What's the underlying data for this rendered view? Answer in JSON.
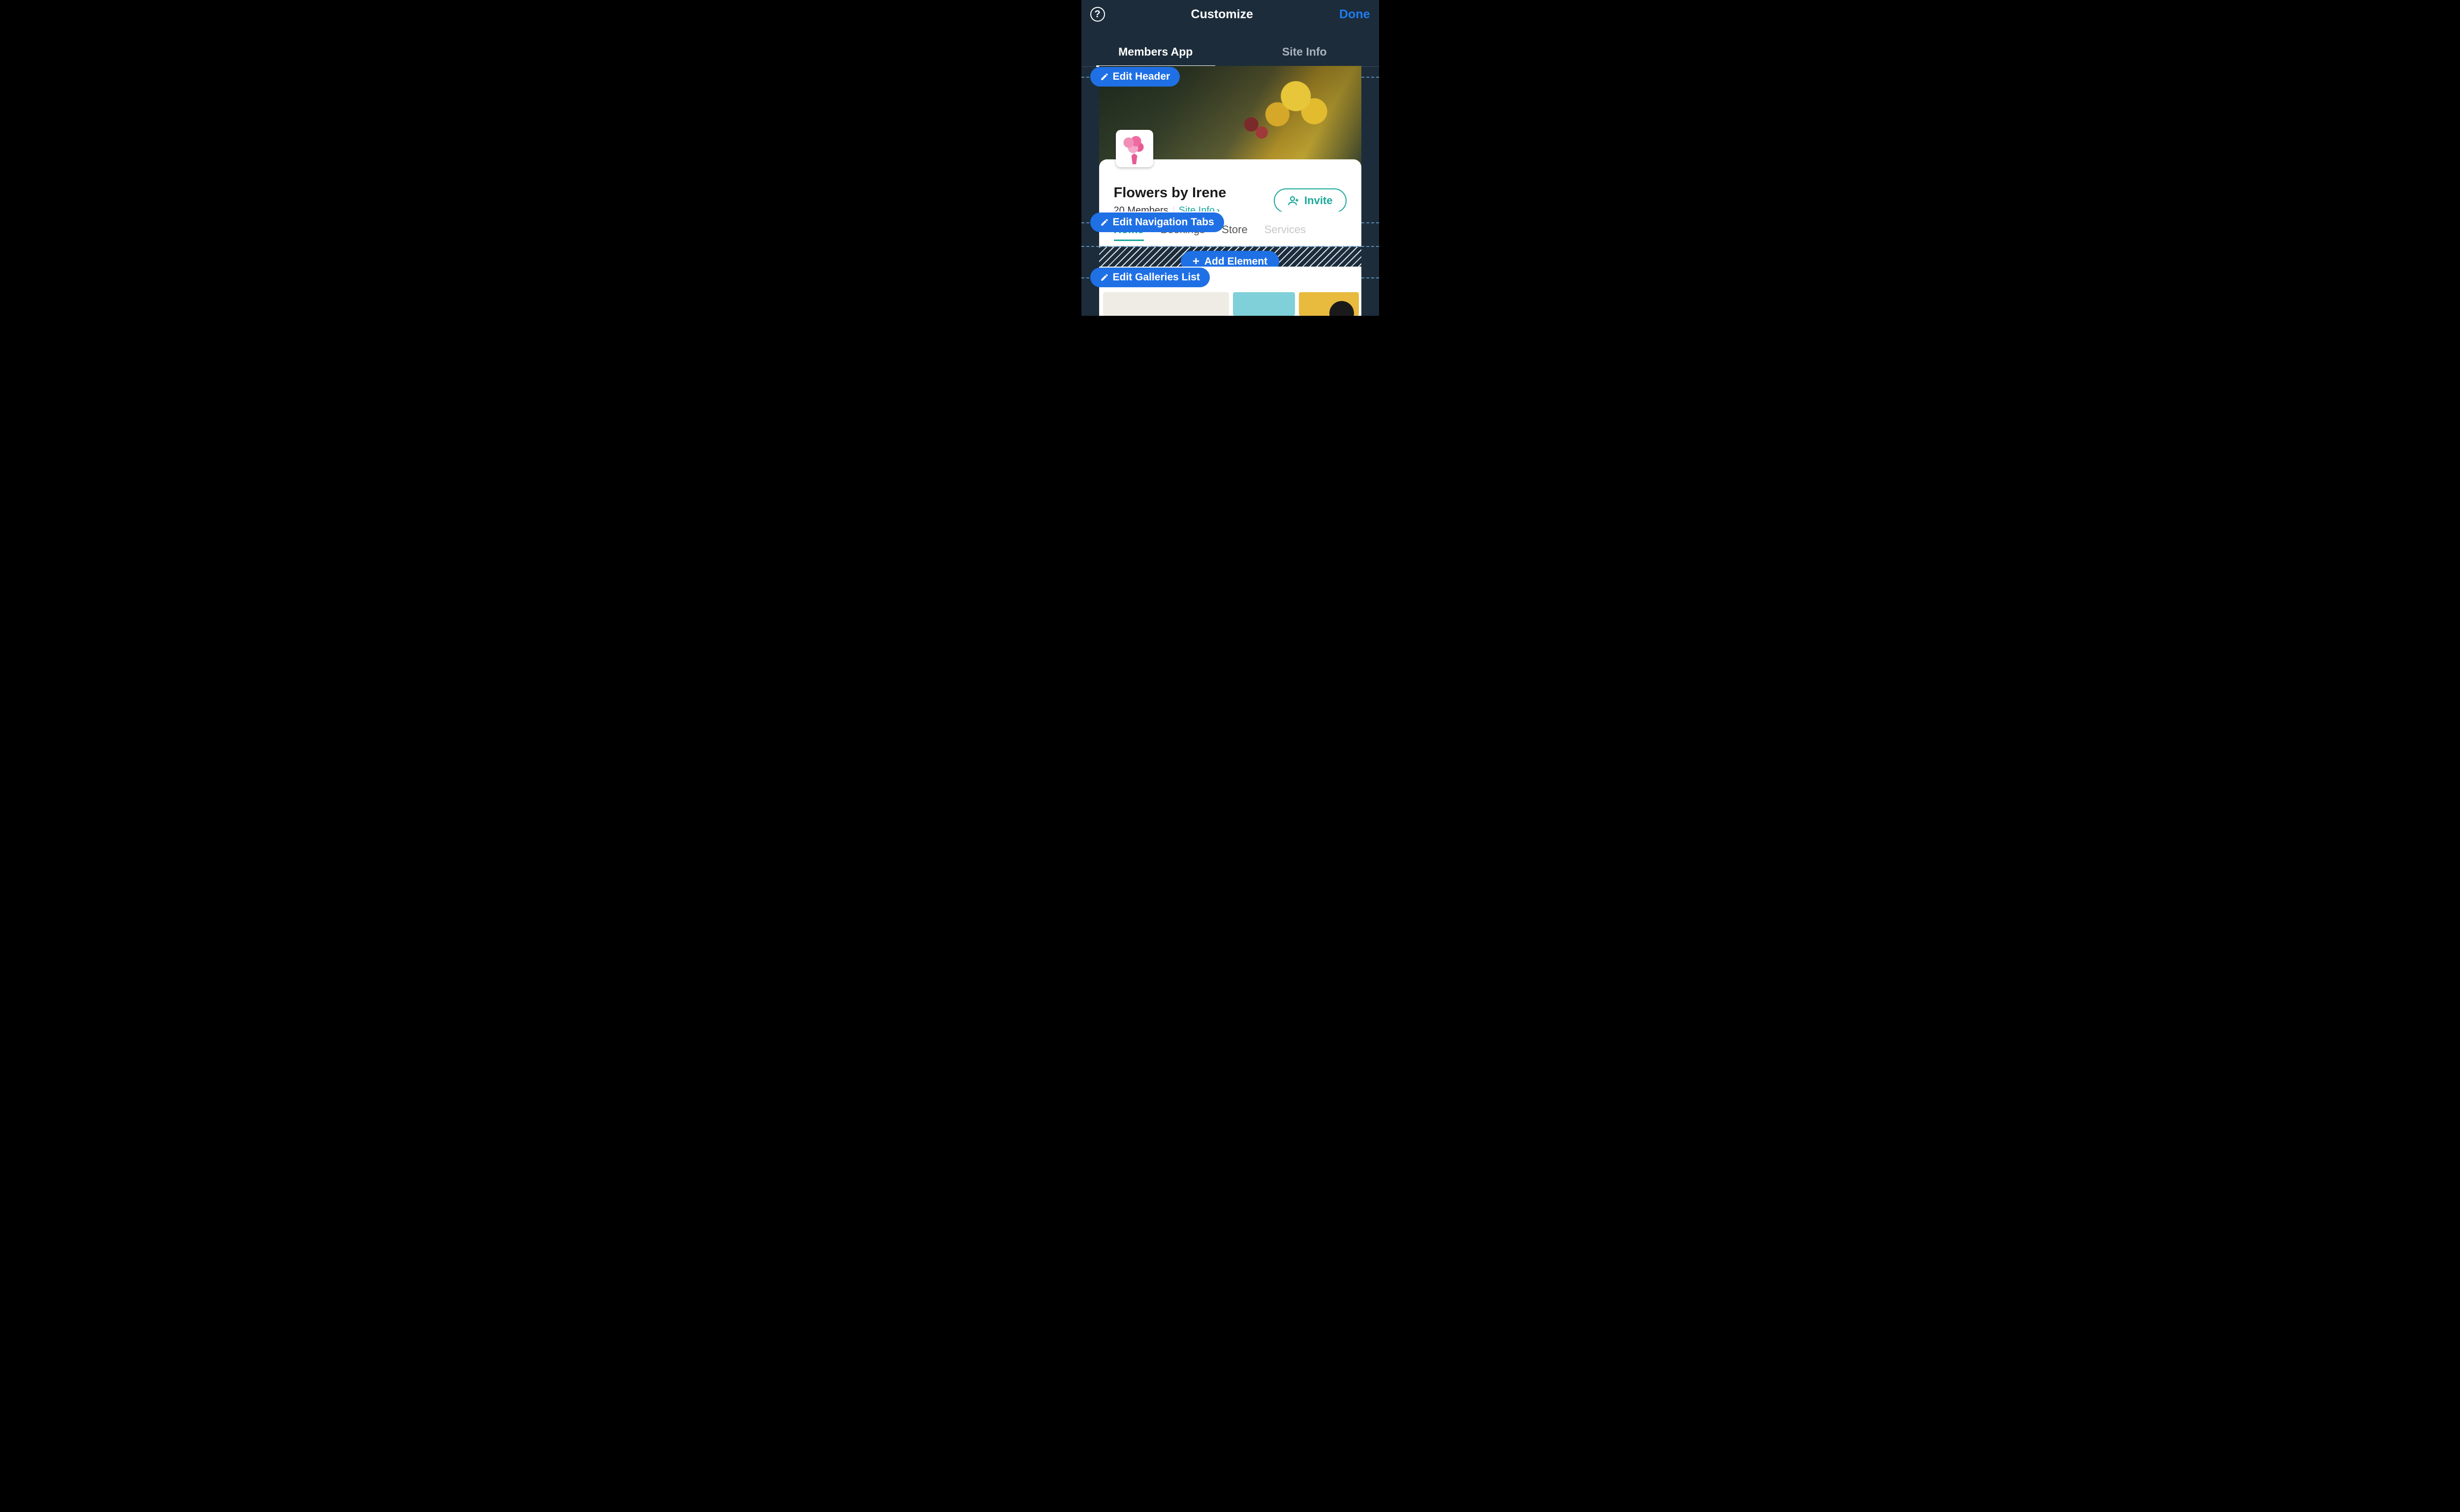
{
  "header": {
    "title": "Customize",
    "done_label": "Done"
  },
  "top_tabs": [
    {
      "label": "Members App",
      "active": true
    },
    {
      "label": "Site Info",
      "active": false
    }
  ],
  "edit_pills": {
    "header": "Edit Header",
    "nav": "Edit Navigation Tabs",
    "galleries": "Edit Galleries List"
  },
  "add_element_label": "Add Element",
  "preview": {
    "site_name": "Flowers by Irene",
    "members_text": "20 Members",
    "site_info_link": "Site Info",
    "invite_label": "Invite",
    "nav_tabs": [
      {
        "label": "Home",
        "active": true
      },
      {
        "label": "Bookings",
        "active": false
      },
      {
        "label": "Store",
        "active": false
      },
      {
        "label": "Services",
        "active": false,
        "fade": true
      }
    ]
  }
}
